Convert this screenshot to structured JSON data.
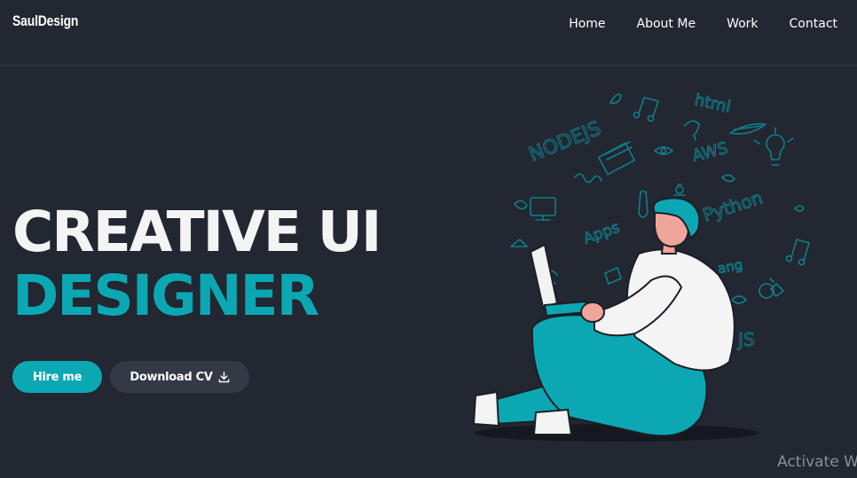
{
  "header": {
    "logo": "SaulDesign",
    "nav": [
      "Home",
      "About Me",
      "Work",
      "Contact"
    ]
  },
  "hero": {
    "line1": "CREATIVE UI",
    "line2": "DESIGNER",
    "hire_label": "Hire me",
    "cv_label": "Download CV",
    "cv_icon": "download-icon"
  },
  "illustration": {
    "doodles": [
      "NODEJS",
      "html",
      "AWS",
      "Python",
      "JS",
      "Apps",
      "ang"
    ]
  },
  "watermark": "Activate W",
  "colors": {
    "background": "#222731",
    "accent": "#0ba8b4",
    "secondary_button": "#343a45",
    "text": "#ffffff"
  }
}
